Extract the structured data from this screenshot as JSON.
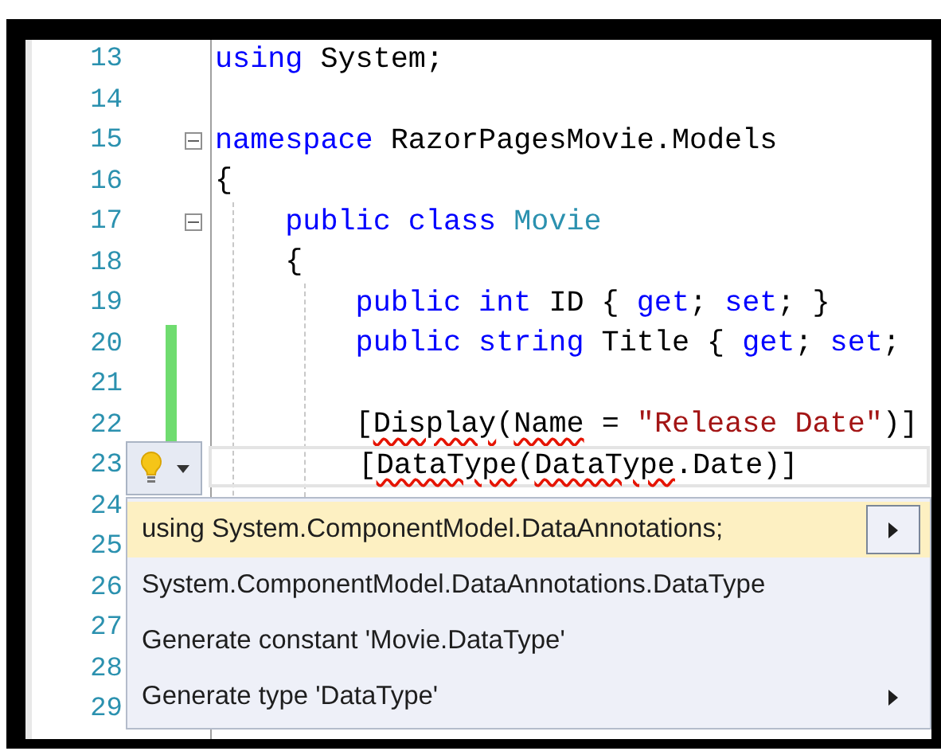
{
  "editor": {
    "lines": [
      {
        "number": "13",
        "tokens": [
          {
            "kind": "keyword",
            "text": "using"
          },
          {
            "kind": "plain",
            "text": " System;"
          }
        ]
      },
      {
        "number": "14"
      },
      {
        "number": "15",
        "foldable": true,
        "tokens": [
          {
            "kind": "keyword",
            "text": "namespace"
          },
          {
            "kind": "plain",
            "text": " RazorPagesMovie.Models"
          }
        ]
      },
      {
        "number": "16",
        "tokens": [
          {
            "kind": "plain",
            "text": "{"
          }
        ]
      },
      {
        "number": "17",
        "foldable": true,
        "tokens": [
          {
            "kind": "keyword",
            "text": "    public class "
          },
          {
            "kind": "type",
            "text": "Movie"
          }
        ]
      },
      {
        "number": "18",
        "tokens": [
          {
            "kind": "plain",
            "text": "    {"
          }
        ]
      },
      {
        "number": "19",
        "tokens": [
          {
            "kind": "keyword",
            "text": "        public int"
          },
          {
            "kind": "plain",
            "text": " ID { "
          },
          {
            "kind": "keyword",
            "text": "get"
          },
          {
            "kind": "plain",
            "text": "; "
          },
          {
            "kind": "keyword",
            "text": "set"
          },
          {
            "kind": "plain",
            "text": "; }"
          }
        ]
      },
      {
        "number": "20",
        "modified": true,
        "tokens": [
          {
            "kind": "keyword",
            "text": "        public string"
          },
          {
            "kind": "plain",
            "text": " Title { "
          },
          {
            "kind": "keyword",
            "text": "get"
          },
          {
            "kind": "plain",
            "text": "; "
          },
          {
            "kind": "keyword",
            "text": "set"
          },
          {
            "kind": "plain",
            "text": ";"
          }
        ]
      },
      {
        "number": "21",
        "modified": true
      },
      {
        "number": "22",
        "modified": true,
        "tokens": [
          {
            "kind": "plain",
            "text": "        ["
          },
          {
            "kind": "plain",
            "text": "Display",
            "squiggle": true
          },
          {
            "kind": "plain",
            "text": "("
          },
          {
            "kind": "plain",
            "text": "Name",
            "squiggle": true
          },
          {
            "kind": "plain",
            "text": " = "
          },
          {
            "kind": "string",
            "text": "\"Release Date\""
          },
          {
            "kind": "plain",
            "text": ")]"
          }
        ]
      },
      {
        "number": "23",
        "current": true,
        "tokens": [
          {
            "kind": "plain",
            "text": "        ["
          },
          {
            "kind": "plain",
            "text": "DataType",
            "squiggle": true
          },
          {
            "kind": "plain",
            "text": "("
          },
          {
            "kind": "plain",
            "text": "DataType",
            "squiggle": true
          },
          {
            "kind": "plain",
            "text": ".Date)]"
          }
        ]
      },
      {
        "number": "24"
      },
      {
        "number": "25"
      },
      {
        "number": "26"
      },
      {
        "number": "27"
      },
      {
        "number": "28"
      },
      {
        "number": "29"
      }
    ]
  },
  "quick_actions": {
    "items": [
      {
        "label": "using System.ComponentModel.DataAnnotations;",
        "selected": true,
        "submenu": true
      },
      {
        "label": "System.ComponentModel.DataAnnotations.DataType",
        "selected": false,
        "submenu": false
      },
      {
        "label": "Generate constant 'Movie.DataType'",
        "selected": false,
        "submenu": false
      },
      {
        "label": "Generate type 'DataType'",
        "selected": false,
        "submenu": true
      }
    ]
  }
}
